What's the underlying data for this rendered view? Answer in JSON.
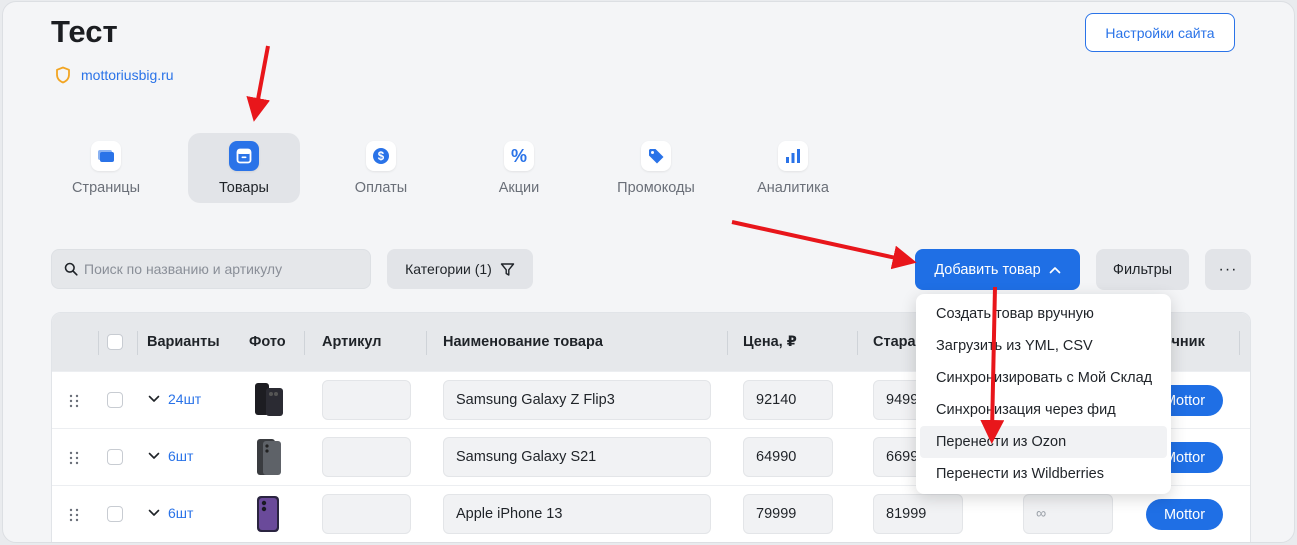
{
  "page": {
    "title": "Тест",
    "domain": "mottoriusbig.ru",
    "settings_label": "Настройки сайта"
  },
  "tabs": [
    {
      "label": "Страницы",
      "icon": "pages-icon",
      "active": false
    },
    {
      "label": "Товары",
      "icon": "products-icon",
      "active": true
    },
    {
      "label": "Оплаты",
      "icon": "dollar-icon",
      "active": false
    },
    {
      "label": "Акции",
      "icon": "percent-icon",
      "active": false
    },
    {
      "label": "Промокоды",
      "icon": "tag-icon",
      "active": false
    },
    {
      "label": "Аналитика",
      "icon": "chart-icon",
      "active": false
    }
  ],
  "toolbar": {
    "search_placeholder": "Поиск по названию и артикулу",
    "categories_label": "Категории (1)",
    "add_product_label": "Добавить товар",
    "filters_label": "Фильтры",
    "more_label": "···"
  },
  "table": {
    "columns": [
      "Варианты",
      "Фото",
      "Артикул",
      "Наименование товара",
      "Цена, ₽",
      "Стара",
      "очник"
    ],
    "rows": [
      {
        "variants": "24шт",
        "sku": "",
        "name": "Samsung Galaxy Z Flip3",
        "price": "92140",
        "old_price": "9499",
        "stock": "",
        "source": "Mottor"
      },
      {
        "variants": "6шт",
        "sku": "",
        "name": "Samsung Galaxy S21",
        "price": "64990",
        "old_price": "6699",
        "stock": "",
        "source": "Mottor"
      },
      {
        "variants": "6шт",
        "sku": "",
        "name": "Apple iPhone 13",
        "price": "79999",
        "old_price": "81999",
        "stock": "∞",
        "source": "Mottor"
      }
    ]
  },
  "dropdown": {
    "items": [
      "Создать товар вручную",
      "Загрузить из YML, CSV",
      "Синхронизировать с Мой Склад",
      "Синхронизация через фид",
      "Перенести из Ozon",
      "Перенести из Wildberries"
    ],
    "hover_index": 4
  },
  "colors": {
    "accent": "#1f6fe5",
    "link": "#2a73e8",
    "annotation_arrow": "#e8161b",
    "shield": "#f2a523"
  }
}
